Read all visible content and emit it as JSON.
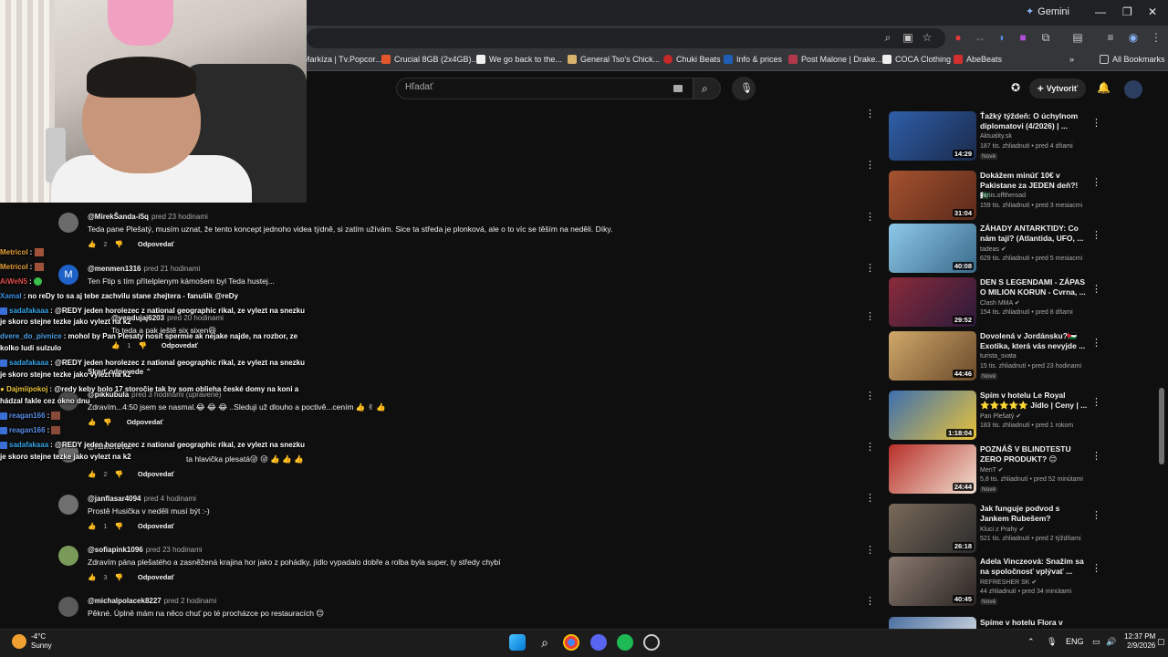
{
  "browser": {
    "gemini_label": "Gemini",
    "all_bookmarks": "All Bookmarks",
    "bookmarks": [
      {
        "label": "Markíza | Tv.Popcor...",
        "color": "#3b7bd8"
      },
      {
        "label": "Crucial 8GB (2x4GB)...",
        "color": "#e2562b"
      },
      {
        "label": "We go back to the...",
        "color": "#f1f1f1"
      },
      {
        "label": "General Tso's Chick...",
        "color": "#d8b26b"
      },
      {
        "label": "Chuki Beats",
        "color": "#c62828"
      },
      {
        "label": "Info & prices",
        "color": "#1e5fb5"
      },
      {
        "label": "Post Malone | Drake...",
        "color": "#b0384a"
      },
      {
        "label": "COCA Clothing",
        "color": "#eeeeee"
      },
      {
        "label": "AbeBeats",
        "color": "#d32f2f"
      }
    ]
  },
  "youtube": {
    "search_placeholder": "Hľadať",
    "create_label": "Vytvoriť"
  },
  "comments": [
    {
      "avatar": "",
      "avatar_color": "#6b6b6b",
      "author": "@MirekŠanda-i5q",
      "time": "pred 23 hodinami",
      "text": "Teda pane Plešatý, musím uznat, že tento koncept jednoho videa týdně, si zatím užívám. Sice ta středa je plonková, ale o to víc se těším na neděli. Díky.",
      "likes": "2",
      "reply": "Odpovedať"
    },
    {
      "avatar": "M",
      "avatar_color": "#1e62c8",
      "author": "@menmen1316",
      "time": "pred 21 hodinami",
      "text": "Ten Ftip s tím přítelplenym  kámošem byl Teda hustej...",
      "likes": "",
      "reply": ""
    },
    {
      "avatar": "",
      "avatar_color": "#5d4a3a",
      "author": "@vendujaj6203",
      "time": "pred 20 hodinami",
      "text": "To teda a pak ještě six sixen😆",
      "likes": "1",
      "reply": "Odpovedať"
    },
    {
      "avatar": "",
      "avatar_color": "#4a4a4a",
      "author": "@pikkubula",
      "time": "pred 3 hodinami (upravené)",
      "text": "Zdravím...4:50 jsem se nasmal.😂 😂 😂 ..Sleduji už dlouho a poctivě...cením 👍 ✌ 👍",
      "likes": "",
      "reply": "Odpovedať"
    },
    {
      "avatar": "",
      "avatar_color": "#6a6a6a",
      "author": "@ramenovat",
      "time": "",
      "text": "ta hlavička plesatá😜 😜 👍 👍 👍",
      "likes": "2",
      "reply": "Odpovedať"
    },
    {
      "avatar": "",
      "avatar_color": "#6f6f6f",
      "author": "@janflasar4094",
      "time": "pred 4 hodinami",
      "text": "Prostě Husička v neděli musí být :-)",
      "likes": "1",
      "reply": "Odpovedať"
    },
    {
      "avatar": "",
      "avatar_color": "#7a9a5a",
      "author": "@sofiapink1096",
      "time": "pred 23 hodinami",
      "text": "Zdravím pána plešatého a zasněžená krajina hor jako z pohádky, jídlo vypadalo dobře a rolba byla super, ty středy chybí",
      "likes": "3",
      "reply": "Odpovedať"
    },
    {
      "avatar": "",
      "avatar_color": "#5a5a5a",
      "author": "@michalpolacek8227",
      "time": "pred 2 hodinami",
      "text": "Pěkné. Úplně mám na něco chuť po té procházce po restauracích 😊",
      "likes": "",
      "reply": ""
    }
  ],
  "replies_toggle": "Skryť odpovede",
  "chat": [
    {
      "user": "Metricol",
      "color": "#e8a23a",
      "text": ""
    },
    {
      "user": "Metricol",
      "color": "#e8a23a",
      "text": ""
    },
    {
      "user": "AiWeN5",
      "color": "#e34d4d",
      "text": ""
    },
    {
      "user": "Xamal",
      "color": "#3a8fe0",
      "text": "no reDy to sa aj tebe zachvilu stane zhejtera - fanušik @reDy"
    },
    {
      "user": "sadafakaaa",
      "color": "#35a6e8",
      "text": "@REDY jeden horolezec z national geographic rikal, ze vylezt na snezku"
    },
    {
      "user": "",
      "color": "#ffffff",
      "text": "je skoro stejne tezke jako vylezt na k2"
    },
    {
      "user": "dvere_do_pivnice",
      "color": "#4fa0e8",
      "text": "mohol by Pan Plesaty nosit spermie ak nejake najde, na rozbor, ze"
    },
    {
      "user": "",
      "color": "#ffffff",
      "text": "kolko ludi sulzulo"
    },
    {
      "user": "sadafakaaa",
      "color": "#35a6e8",
      "text": "@REDY jeden horolezec z national geographic rikal, ze vylezt na snezku"
    },
    {
      "user": "",
      "color": "#ffffff",
      "text": "je skoro stejne tezke jako vylezt na k2"
    },
    {
      "user": "Dajmiipokoj",
      "color": "#e8c33a",
      "text": "@redy keby bolo 17 storočie tak by som oblieha české domy na koni a"
    },
    {
      "user": "",
      "color": "#ffffff",
      "text": "hádzal fakle cez okno dnu"
    },
    {
      "user": "reagan166",
      "color": "#5a8fe8",
      "text": ""
    },
    {
      "user": "reagan166",
      "color": "#5a8fe8",
      "text": ""
    },
    {
      "user": "sadafakaaa",
      "color": "#35a6e8",
      "text": "@REDY jeden horolezec z national geographic rikal, ze vylezt na snezku"
    },
    {
      "user": "",
      "color": "#ffffff",
      "text": "je skoro stejne tezke jako vylezt na k2"
    }
  ],
  "sidebar": [
    {
      "title": "Ťažký týždeň: O úchylnom diplomatovi (4/2026) | ...",
      "channel": "Aktuality.sk",
      "meta": "187 tis. zhliadnutí • pred 4 dňami",
      "badge": "Nové",
      "duration": "14:29",
      "thumb": "#2f5fa8",
      "verified": false
    },
    {
      "title": "Dokážem minúť 10€ v Pakistane za JEDEN deň?! 🇵🇰",
      "channel": "denis.offtheroad",
      "meta": "159 tis. zhliadnutí • pred 3 mesiacmi",
      "badge": "",
      "duration": "31:04",
      "thumb": "#a5522f",
      "verified": false
    },
    {
      "title": "ZÁHADY ANTARKTIDY: Co nám tají? (Atlantida, UFO, ...",
      "channel": "tadeas",
      "meta": "629 tis. zhliadnutí • pred 5 mesiacmi",
      "badge": "",
      "duration": "40:08",
      "thumb": "#6fa9c9",
      "verified": true
    },
    {
      "title": "DEN S LEGENDAMI - ZÁPAS O MILION KORUN - Cvrna, ...",
      "channel": "Clash MMA",
      "meta": "154 tis. zhliadnutí • pred 8 dňami",
      "badge": "",
      "duration": "29:52",
      "thumb": "#8a2b3a",
      "verified": true
    },
    {
      "title": "Dovolená v Jordánsku?🇯🇴 Exotika, která vás nevyjde ...",
      "channel": "turista_svata",
      "meta": "15 tis. zhliadnutí • pred 23 hodinami",
      "badge": "Nové",
      "duration": "44:46",
      "thumb": "#b0894f",
      "verified": false
    },
    {
      "title": "Spím v hotelu Le Royal ⭐⭐⭐⭐⭐ Jídlo | Ceny | ...",
      "channel": "Pan Plešatý",
      "meta": "183 tis. zhliadnutí • pred 1 rokom",
      "badge": "",
      "duration": "1:18:04",
      "thumb": "#3d6fb0",
      "verified": true
    },
    {
      "title": "POZNÁŠ V BLINDTESTU ZERO PRODUKT? 😊",
      "channel": "MenT",
      "meta": "5,8 tis. zhliadnutí • pred 52 minútami",
      "badge": "Nové",
      "duration": "24:44",
      "thumb": "#b8302a",
      "verified": true
    },
    {
      "title": "Jak funguje podvod s Jankem Rubešem?",
      "channel": "Kluci z Prahy",
      "meta": "521 tis. zhliadnutí • pred 2 týždňami",
      "badge": "",
      "duration": "26:18",
      "thumb": "#7a6a5a",
      "verified": true
    },
    {
      "title": "Adela Vinczeová: Snažím sa na spoločnosť vplývať ...",
      "channel": "REFRESHER SK",
      "meta": "44 zhliadnutí • pred 34 minútami",
      "badge": "Nové",
      "duration": "40:45",
      "thumb": "#5a4f4a",
      "verified": true
    },
    {
      "title": "Spíme v hotelu Flora v",
      "channel": "",
      "meta": "",
      "badge": "",
      "duration": "",
      "thumb": "#4a6fa0",
      "verified": false
    }
  ],
  "taskbar": {
    "temp": "-4°C",
    "condition": "Sunny",
    "lang": "ENG",
    "time": "12:37 PM",
    "date": "2/9/2026"
  }
}
